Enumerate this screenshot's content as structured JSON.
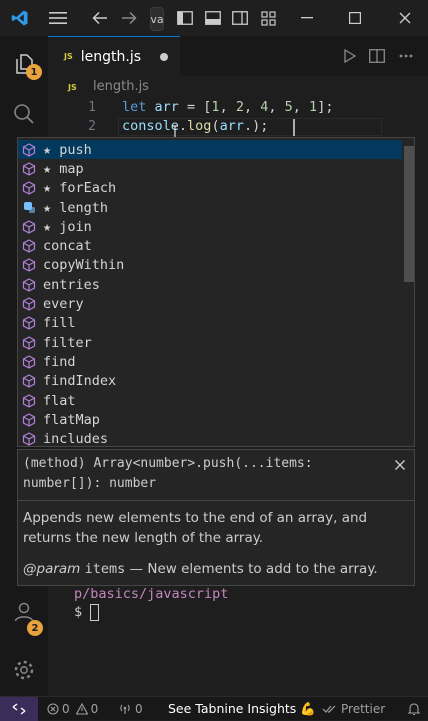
{
  "titlebar": {
    "command_center_text": "va"
  },
  "activity_bar": {
    "explorer_badge": "1",
    "accounts_badge": "2"
  },
  "tabs": [
    {
      "label": "length.js",
      "file_type": "JS",
      "modified": true
    }
  ],
  "breadcrumb": {
    "file_type": "JS",
    "label": "length.js"
  },
  "editor": {
    "lines": [
      {
        "number": "1",
        "tokens": [
          "let",
          " arr",
          " = [",
          "1",
          ", ",
          "2",
          ", ",
          "4",
          ", ",
          "5",
          ", ",
          "1",
          "];"
        ]
      },
      {
        "number": "2",
        "tokens": [
          "console",
          ".",
          "log",
          "(",
          "arr",
          ".",
          ");"
        ]
      }
    ]
  },
  "suggest": {
    "items": [
      {
        "label": "★ push",
        "kind": "method",
        "selected": true
      },
      {
        "label": "★ map",
        "kind": "method"
      },
      {
        "label": "★ forEach",
        "kind": "method"
      },
      {
        "label": "★ length",
        "kind": "property"
      },
      {
        "label": "★ join",
        "kind": "method"
      },
      {
        "label": "concat",
        "kind": "method"
      },
      {
        "label": "copyWithin",
        "kind": "method"
      },
      {
        "label": "entries",
        "kind": "method"
      },
      {
        "label": "every",
        "kind": "method"
      },
      {
        "label": "fill",
        "kind": "method"
      },
      {
        "label": "filter",
        "kind": "method"
      },
      {
        "label": "find",
        "kind": "method"
      },
      {
        "label": "findIndex",
        "kind": "method"
      },
      {
        "label": "flat",
        "kind": "method"
      },
      {
        "label": "flatMap",
        "kind": "method"
      },
      {
        "label": "includes",
        "kind": "method"
      }
    ]
  },
  "details": {
    "signature": "(method) Array<number>.push(...items: number[]): number",
    "description": "Appends new elements to the end of an array, and returns the new length of the array.",
    "param_tag": "@param",
    "param_name": "items",
    "param_desc": " — New elements to add to the array."
  },
  "terminal": {
    "path": "p/basics/javascript",
    "prompt": "$"
  },
  "status_bar": {
    "errors": "0",
    "warnings": "0",
    "ports": "0",
    "tabnine": "See Tabnine Insights 💪",
    "prettier": "Prettier"
  },
  "colors": {
    "accent": "#0078d4",
    "badge": "#e8a33d",
    "method_icon": "#b180d7",
    "property_icon": "#75beff"
  }
}
